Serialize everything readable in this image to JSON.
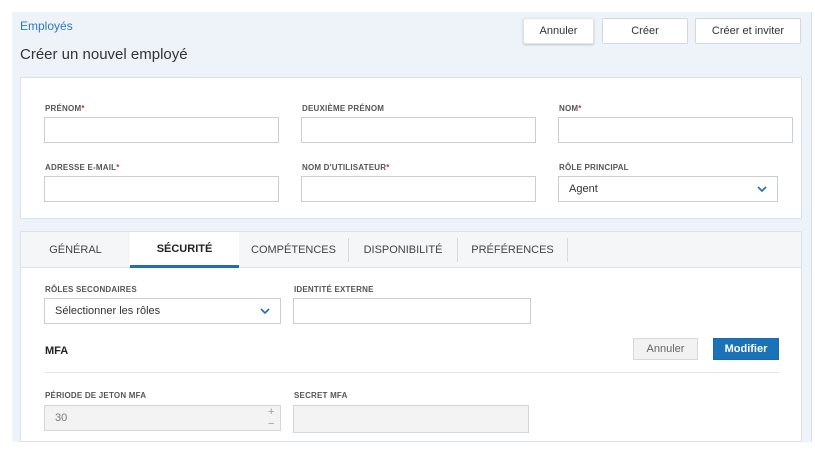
{
  "header": {
    "breadcrumb": "Employés",
    "title": "Créer un nouvel employé",
    "buttons": {
      "cancel": "Annuler",
      "create": "Créer",
      "create_invite": "Créer et inviter"
    }
  },
  "form": {
    "first_name": {
      "label": "PRÉNOM",
      "required": "*",
      "value": ""
    },
    "middle_name": {
      "label": "DEUXIÈME PRÉNOM",
      "value": ""
    },
    "last_name": {
      "label": "NOM",
      "required": "*",
      "value": ""
    },
    "email": {
      "label": "ADRESSE E-MAIL",
      "required": "*",
      "value": ""
    },
    "username": {
      "label": "NOM D'UTILISATEUR",
      "required": "*",
      "value": ""
    },
    "primary_role": {
      "label": "RÔLE PRINCIPAL",
      "value": "Agent"
    }
  },
  "tabs": [
    {
      "label": "GÉNÉRAL",
      "active": false
    },
    {
      "label": "SÉCURITÉ",
      "active": true
    },
    {
      "label": "COMPÉTENCES",
      "active": false
    },
    {
      "label": "DISPONIBILITÉ",
      "active": false
    },
    {
      "label": "PRÉFÉRENCES",
      "active": false
    }
  ],
  "security": {
    "secondary_roles": {
      "label": "RÔLES SECONDAIRES",
      "value": "Sélectionner les rôles"
    },
    "external_identity": {
      "label": "IDENTITÉ EXTERNE",
      "value": ""
    },
    "mfa": {
      "title": "MFA",
      "cancel_label": "Annuler",
      "edit_label": "Modifier",
      "token_period": {
        "label": "PÉRIODE DE JETON MFA",
        "value": "30"
      },
      "secret": {
        "label": "SECRET MFA",
        "value": ""
      },
      "stepper_up": "+",
      "stepper_down": "−"
    }
  },
  "colors": {
    "accent": "#1a73b9",
    "link": "#2a78c2",
    "required": "#c0392b",
    "page_bg": "#eef3f9"
  }
}
